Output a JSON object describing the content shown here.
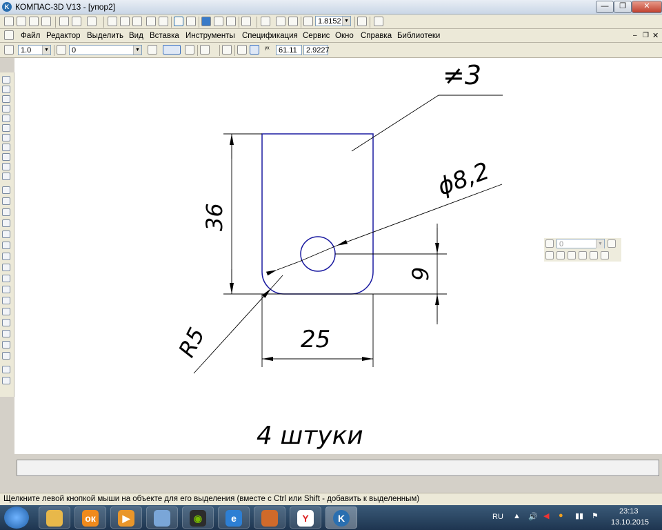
{
  "window": {
    "title": "КОМПАС-3D V13 - [упор2]",
    "app_icon_letter": "K",
    "buttons": {
      "minimize": "—",
      "maximize": "❐",
      "close": "✕"
    }
  },
  "toolbar1": {
    "zoom_value": "1.8152"
  },
  "menubar": {
    "items": [
      "Файл",
      "Редактор",
      "Выделить",
      "Вид",
      "Вставка",
      "Инструменты",
      "Спецификация",
      "Сервис",
      "Окно",
      "Справка",
      "Библиотеки"
    ]
  },
  "toolbar2": {
    "step_value": "1.0",
    "layer_value": "0",
    "coord_x": "61.11",
    "coord_y": "2.9227"
  },
  "floatbar": {
    "layer_value": "0"
  },
  "drawing": {
    "thickness_label": "≠3",
    "hole_label": "ϕ8,2",
    "height_label": "36",
    "hole_offset_label": "9",
    "width_label": "25",
    "radius_label": "R5",
    "note": "4 штуки"
  },
  "status": {
    "message": "Щелкните левой кнопкой мыши на объекте для его выделения (вместе с Ctrl или Shift - добавить к выделенным)"
  },
  "taskbar": {
    "lang": "RU",
    "time": "23:13",
    "date": "13.10.2015"
  },
  "colors": {
    "part_outline": "#1a1aa0",
    "dimension": "#000000",
    "canvas": "#ffffff"
  }
}
